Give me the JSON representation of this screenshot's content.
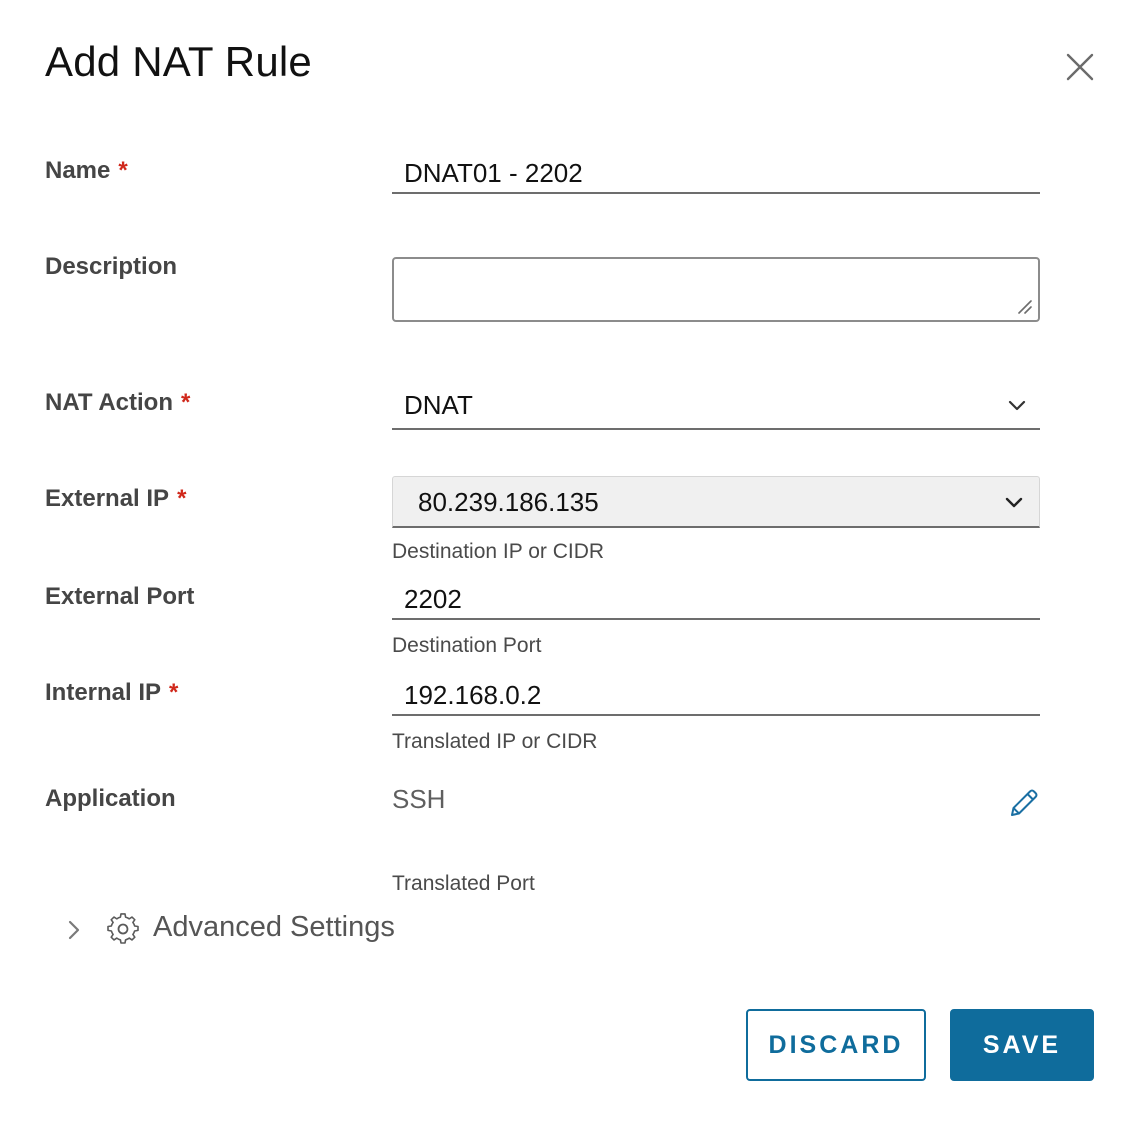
{
  "dialog": {
    "title": "Add NAT Rule"
  },
  "form": {
    "name": {
      "label": "Name",
      "required_mark": "*",
      "value": "DNAT01 - 2202"
    },
    "description": {
      "label": "Description",
      "value": ""
    },
    "nat_action": {
      "label": "NAT Action",
      "required_mark": "*",
      "value": "DNAT"
    },
    "external_ip": {
      "label": "External IP",
      "required_mark": "*",
      "value": "80.239.186.135",
      "helper": "Destination IP or CIDR"
    },
    "external_port": {
      "label": "External Port",
      "value": "2202",
      "helper": "Destination Port"
    },
    "internal_ip": {
      "label": "Internal IP",
      "required_mark": "*",
      "value": "192.168.0.2",
      "helper": "Translated IP or CIDR"
    },
    "application": {
      "label": "Application",
      "value": "SSH",
      "helper": "Translated Port"
    }
  },
  "advanced": {
    "label": "Advanced Settings",
    "expanded": false
  },
  "footer": {
    "discard_label": "DISCARD",
    "save_label": "SAVE"
  },
  "icons": {
    "close": "close-icon",
    "chevron": "chevron-down-icon",
    "edit": "pencil-icon",
    "gear": "gear-icon",
    "expand": "chevron-right-icon"
  },
  "colors": {
    "accent": "#0f6c9c",
    "required": "#d0281b",
    "label": "#454545"
  }
}
